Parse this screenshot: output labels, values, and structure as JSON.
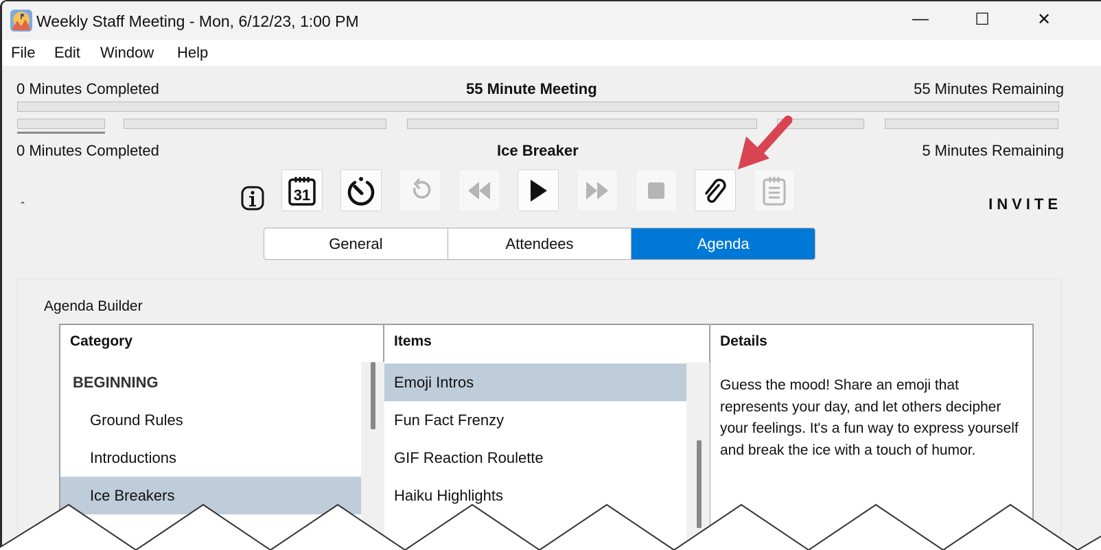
{
  "window": {
    "title": "Weekly Staff Meeting - Mon, 6/12/23, 1:00 PM",
    "minimize": "—",
    "maximize": "☐",
    "close": "✕"
  },
  "menu": [
    "File",
    "Edit",
    "Window",
    "Help"
  ],
  "meeting": {
    "completed": "0 Minutes Completed",
    "title": "55 Minute Meeting",
    "remaining": "55 Minutes Remaining",
    "progress": 0
  },
  "segment": {
    "completed": "0 Minutes Completed",
    "title": "Ice Breaker",
    "remaining": "5 Minutes Remaining",
    "progress": 0,
    "current_index": 0
  },
  "toolbar": {
    "invite": "INVITE",
    "buttons": [
      "calendar",
      "timer",
      "reset",
      "rewind",
      "play",
      "fast-forward",
      "stop",
      "attachment",
      "notes"
    ]
  },
  "tabs": [
    {
      "label": "General",
      "active": false
    },
    {
      "label": "Attendees",
      "active": false
    },
    {
      "label": "Agenda",
      "active": true
    }
  ],
  "agenda": {
    "title": "Agenda Builder",
    "category_header": "Category",
    "items_header": "Items",
    "details_header": "Details",
    "categories": [
      {
        "label": "BEGINNING",
        "group": true
      },
      {
        "label": "Ground Rules"
      },
      {
        "label": "Introductions"
      },
      {
        "label": "Ice Breakers",
        "selected": true
      }
    ],
    "items": [
      {
        "label": "Emoji Intros",
        "selected": true
      },
      {
        "label": "Fun Fact Frenzy"
      },
      {
        "label": "GIF Reaction Roulette"
      },
      {
        "label": "Haiku Highlights"
      }
    ],
    "details": "Guess the mood! Share an emoji that represents your day, and let others decipher your feelings. It's a fun way to express yourself and break the ice with a touch of humor."
  },
  "colors": {
    "accent": "#0078d7",
    "selection": "#bfccda",
    "annotation_arrow": "#d94452"
  }
}
